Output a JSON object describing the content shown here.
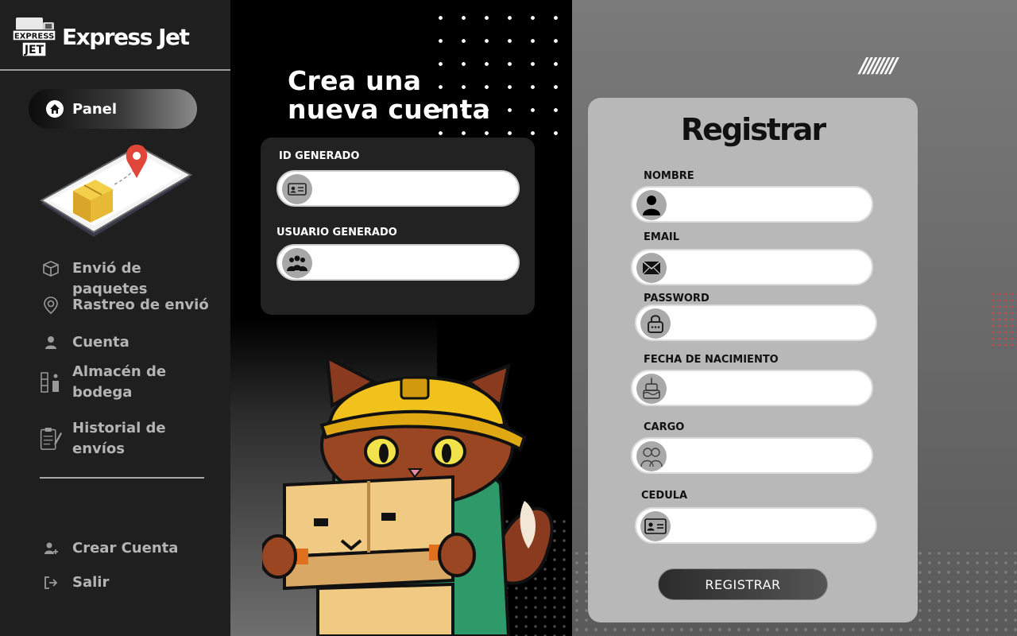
{
  "brand": {
    "name": "Express Jet",
    "logo_line1": "EXPRESS",
    "logo_line2": "JET"
  },
  "sidebar": {
    "panel": {
      "label": "Panel",
      "icon": "home-icon"
    },
    "items": [
      {
        "label": "Envió de paquetes",
        "icon": "package-icon"
      },
      {
        "label": "Rastreo de envió",
        "icon": "location-pin-icon"
      },
      {
        "label": "Cuenta",
        "icon": "user-icon"
      },
      {
        "label": "Almacén de bodega",
        "icon": "warehouse-icon"
      },
      {
        "label": "Historial de envíos",
        "icon": "history-icon"
      }
    ],
    "bottom": [
      {
        "label": "Crear Cuenta",
        "icon": "add-user-icon"
      },
      {
        "label": "Salir",
        "icon": "logout-icon"
      }
    ]
  },
  "main": {
    "headline_line1": "Crea una",
    "headline_line2": "nueva cuenta",
    "generated": {
      "id_label": "ID GENERADO",
      "id_value": "",
      "user_label": "USUARIO GENERADO",
      "user_value": ""
    }
  },
  "register": {
    "title": "Registrar",
    "fields": {
      "nombre": {
        "label": "NOMBRE",
        "value": ""
      },
      "email": {
        "label": "EMAIL",
        "value": ""
      },
      "password": {
        "label": "PASSWORD",
        "value": ""
      },
      "fecha": {
        "label": "FECHA DE NACIMIENTO",
        "value": ""
      },
      "cargo": {
        "label": "CARGO",
        "value": ""
      },
      "cedula": {
        "label": "CEDULA",
        "value": ""
      }
    },
    "button": "REGISTRAR"
  },
  "decor": {
    "slashes": "////////"
  },
  "colors": {
    "sidebar_bg": "#1f1f1f",
    "card_bg": "#b8b8b8",
    "gen_card_bg": "#222222",
    "accent_red": "#e0463a"
  }
}
